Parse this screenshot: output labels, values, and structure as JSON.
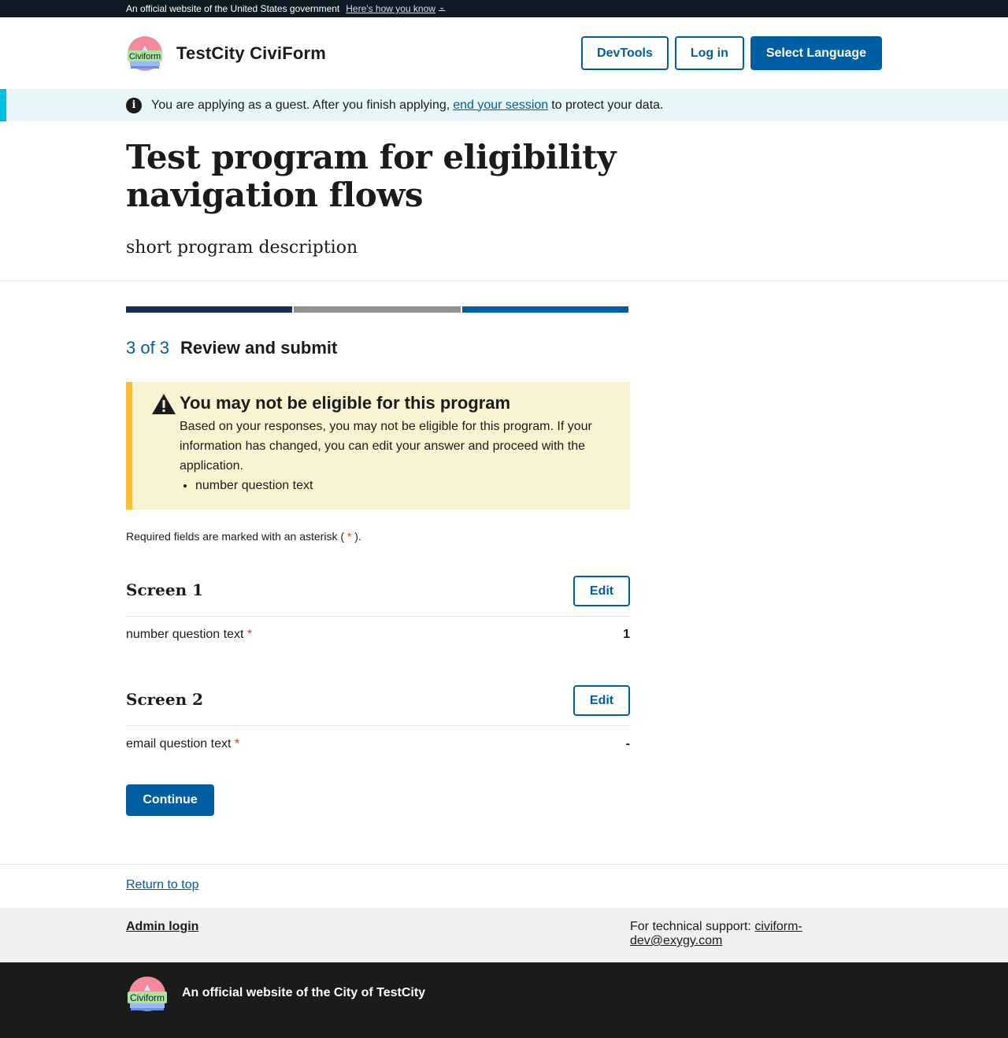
{
  "gov_banner": {
    "text": "An official website of the United States government",
    "link": "Here's how you know",
    "chevron_icon": "chevron-down-icon"
  },
  "header": {
    "logo_text": "Civiform",
    "site_title": "TestCity CiviForm",
    "buttons": {
      "devtools": "DevTools",
      "login": "Log in",
      "language": "Select Language"
    }
  },
  "guest_alert": {
    "before": "You are applying as a guest. After you finish applying,",
    "link": "end your session",
    "after": "to protect your data."
  },
  "program": {
    "title": "Test program for eligibility navigation flows",
    "description": "short program description"
  },
  "progress": {
    "current": 3,
    "total": 3,
    "step_count": "3 of 3",
    "step_title": "Review and submit"
  },
  "eligibility_alert": {
    "title": "You may not be eligible for this program",
    "body": "Based on your responses, you may not be eligible for this program. If your information has changed, you can edit your answer and proceed with the application.",
    "items": [
      "number question text"
    ]
  },
  "required_note": {
    "before": "Required fields are marked with an asterisk (",
    "asterisk": "*",
    "after": ")."
  },
  "screens": [
    {
      "title": "Screen 1",
      "edit_label": "Edit",
      "question": "number question text",
      "required_mark": "*",
      "answer": "1"
    },
    {
      "title": "Screen 2",
      "edit_label": "Edit",
      "question": "email question text",
      "required_mark": "*",
      "answer": "-"
    }
  ],
  "continue_label": "Continue",
  "return_to_top": "Return to top",
  "footer": {
    "admin_login": "Admin login",
    "support_label": "For technical support:",
    "support_email": "civiform-dev@exygy.com",
    "official_text": "An official website of the City of TestCity"
  },
  "colors": {
    "primary": "#005ea2",
    "dark_navy": "#162e51",
    "gray": "#919191",
    "warning_bg": "#faf3d1",
    "warning_border": "#ffbe2e",
    "info_bg": "#e7f6f8",
    "info_border": "#00bde3",
    "asterisk": "#d83933"
  }
}
